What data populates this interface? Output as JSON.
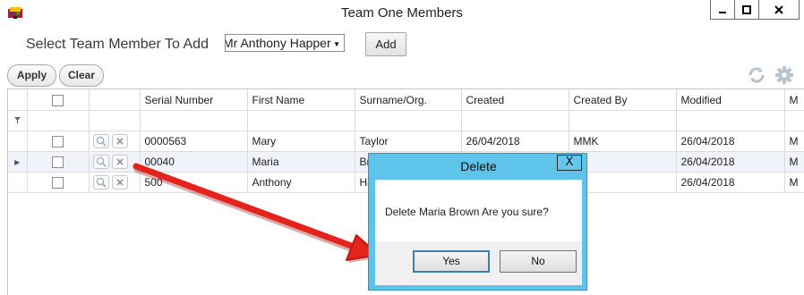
{
  "window": {
    "title": "Team One Members",
    "minimize_icon": "minimize-icon",
    "maximize_icon": "maximize-icon",
    "close_icon": "close-icon"
  },
  "add_member": {
    "label": "Select Team Member To Add",
    "selected": "Mr Anthony Happer",
    "add_label": "Add"
  },
  "toolbar": {
    "apply_label": "Apply",
    "clear_label": "Clear",
    "icons": [
      "refresh-icon",
      "settings-icon"
    ]
  },
  "grid": {
    "columns": [
      "Serial Number",
      "First Name",
      "Surname/Org.",
      "Created",
      "Created By",
      "Modified",
      "M"
    ],
    "rows": [
      {
        "serial": "0000563",
        "first": "Mary",
        "surname": "Taylor",
        "created": "26/04/2018",
        "created_by": "MMK",
        "modified": "26/04/2018",
        "m": "M"
      },
      {
        "serial": "00040",
        "first": "Maria",
        "surname": "Br",
        "created": "",
        "created_by": "K",
        "modified": "26/04/2018",
        "m": "M"
      },
      {
        "serial": "500",
        "first": "Anthony",
        "surname": "Ha",
        "created": "",
        "created_by": "K",
        "modified": "26/04/2018",
        "m": "M"
      }
    ],
    "selected_row": 1
  },
  "dialog": {
    "title": "Delete",
    "close_glyph": "X",
    "message": "Delete Maria Brown Are you sure?",
    "yes_label": "Yes",
    "no_label": "No"
  },
  "colors": {
    "dialog_frame": "#5fc4ea",
    "arrow": "#e3231c",
    "selected_row": "#f1f3fb"
  }
}
